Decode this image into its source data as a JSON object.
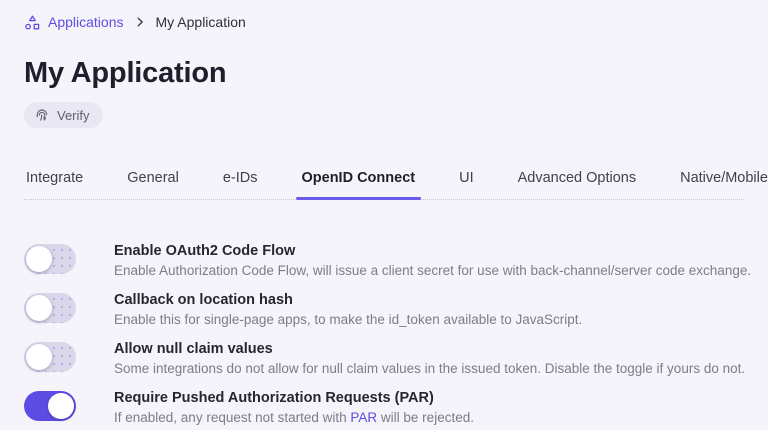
{
  "breadcrumb": {
    "root": "Applications",
    "current": "My Application"
  },
  "header": {
    "title": "My Application",
    "verify_label": "Verify"
  },
  "icons": {
    "breadcrumb": "hierarchy-shapes-icon",
    "separator": "chevron-right-icon",
    "verify": "fingerprint-icon"
  },
  "colors": {
    "accent": "#5c4ce4",
    "background": "#f5f4fb",
    "toggle_off_track": "#d9d7ea"
  },
  "tabs": [
    {
      "label": "Integrate"
    },
    {
      "label": "General"
    },
    {
      "label": "e-IDs"
    },
    {
      "label": "OpenID Connect",
      "active": true
    },
    {
      "label": "UI"
    },
    {
      "label": "Advanced Options"
    },
    {
      "label": "Native/Mobile"
    }
  ],
  "settings": {
    "rows": [
      {
        "title": "Enable OAuth2 Code Flow",
        "desc": "Enable Authorization Code Flow, will issue a client secret for use with back-channel/server code exchange.",
        "state": "off"
      },
      {
        "title": "Callback on location hash",
        "desc": "Enable this for single-page apps, to make the id_token available to JavaScript.",
        "state": "off"
      },
      {
        "title": "Allow null claim values",
        "desc": "Some integrations do not allow for null claim values in the issued token. Disable the toggle if yours do not.",
        "state": "off"
      },
      {
        "title": "Require Pushed Authorization Requests (PAR)",
        "desc_before": "If enabled, any request not started with ",
        "desc_link": "PAR",
        "desc_after": " will be rejected.",
        "state": "on"
      }
    ]
  }
}
